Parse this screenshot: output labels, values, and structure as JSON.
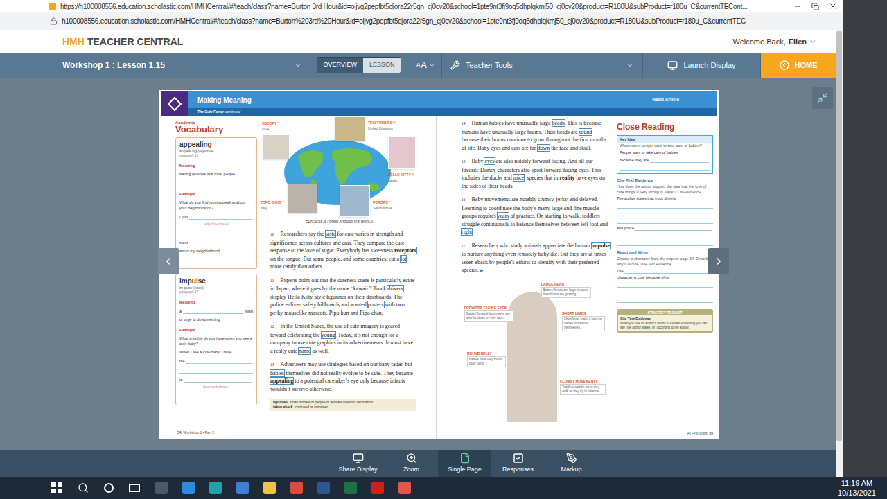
{
  "browser": {
    "title_url": "https://h100008556.education.scholastic.com/HMHCentral/#/teach/class?name=Burton 3rd Hour&id=oijvg2pepfbt5djora22r5gn_cj0cv20&school=1pte9nt3fj9oq5dhplqkmj50_cj0cv20&product=R180U&subProduct=r180u_C&currentTECont...",
    "address": "h100008556.education.scholastic.com/HMHCentral/#/teach/class?name=Burton%203rd%20Hour&id=oijvg2pepfbt5djora22r5gn_cj0cv20&school=1pte9nt3fj9oq5dhplqkmj50_cj0cv20&product=R180U&subProduct=r180u_C&currentTEC",
    "scrollbar": {
      "level": 0.92
    }
  },
  "header": {
    "brand": "HMH",
    "product": "TEACHER CENTRAL",
    "welcome": "Welcome Back,",
    "user": "Ellen"
  },
  "nav": {
    "lesson": "Workshop 1 : Lesson 1.15",
    "view_toggle": [
      {
        "label": "OVERVIEW",
        "selected": true
      },
      {
        "label": "LESSON",
        "selected": false
      }
    ],
    "text_size": {
      "small": "A",
      "large": "A"
    },
    "tools": "Teacher Tools",
    "launch": "Launch Display",
    "home": "HOME"
  },
  "document": {
    "header": {
      "title": "Making Meaning",
      "subtitle": "The Cute Factor",
      "subtitle_tail": "continued",
      "genre": "News Article"
    },
    "vocabulary": {
      "kicker": "Academic",
      "title": "Vocabulary",
      "cards": [
        {
          "word": "appealing",
          "pronunciation": "ap·peal·ing (adjective)",
          "paragraph": "paragraph 13",
          "rows": [
            {
              "kind": "label",
              "text": "Meaning"
            },
            {
              "kind": "text",
              "text": "having qualities that most people"
            },
            {
              "kind": "blank"
            },
            {
              "kind": "label",
              "text": "Example"
            },
            {
              "kind": "italic",
              "text": "What do you find most appealing about your neighborhood?"
            },
            {
              "kind": "fill",
              "before": "I find",
              "after": ""
            },
            {
              "kind": "hint",
              "text": "(adjective phrase)"
            },
            {
              "kind": "blank"
            },
            {
              "kind": "fill",
              "before": "most",
              "after": ""
            },
            {
              "kind": "text",
              "text": "about my neighborhood."
            }
          ]
        },
        {
          "word": "impulse",
          "pronunciation": "im·pulse (noun)",
          "paragraph": "paragraph 17",
          "rows": [
            {
              "kind": "label",
              "text": "Meaning"
            },
            {
              "kind": "fill",
              "before": "a",
              "after": "wish"
            },
            {
              "kind": "text",
              "text": "or urge to do something"
            },
            {
              "kind": "label",
              "text": "Example"
            },
            {
              "kind": "italic",
              "text": "What impulse do you have when you see a cute baby?"
            },
            {
              "kind": "text",
              "text": "When I see a cute baby, I have"
            },
            {
              "kind": "fill",
              "before": "the",
              "after": ""
            },
            {
              "kind": "blank"
            },
            {
              "kind": "fill",
              "before": "to",
              "after": ""
            },
            {
              "kind": "hint",
              "text": "(base verb phrase)"
            }
          ]
        }
      ]
    },
    "map": {
      "pins": [
        {
          "name": "SNOOPY™",
          "country": "USA"
        },
        {
          "name": "TELETUBBIES™",
          "country": "United Kingdom"
        },
        {
          "name": "HELLO KITTY™",
          "country": "Japan"
        },
        {
          "name": "TOPO GIGIO™",
          "country": "Italy"
        },
        {
          "name": "PORORO™",
          "country": "South Korea"
        }
      ],
      "caption": "CUTENESS IS FOUND AROUND THE WORLD."
    },
    "paragraphs_left": [
      {
        "num": "10",
        "parts": [
          {
            "text": "Researchers say the ",
            "bold": false,
            "boxed": false
          },
          {
            "text": "taste",
            "bold": false,
            "boxed": true
          },
          {
            "text": " for cute varies in strength and significance across cultures and eras. They compare the cute response to the love of sugar. Everybody has sweetness ",
            "bold": false,
            "boxed": false
          },
          {
            "text": "receptors",
            "bold": true,
            "boxed": true
          },
          {
            "text": " on the tongue. But some people, and some countries, eat a ",
            "bold": false,
            "boxed": false
          },
          {
            "text": "lot",
            "bold": false,
            "boxed": true
          },
          {
            "text": " more candy than others.",
            "bold": false,
            "boxed": false
          }
        ]
      },
      {
        "num": "11",
        "parts": [
          {
            "text": "Experts point out that the cuteness craze is particularly acute in Japan, where it goes by the name “kawaii.” Truck ",
            "bold": false,
            "boxed": false
          },
          {
            "text": "drivers",
            "bold": false,
            "boxed": true
          },
          {
            "text": " display Hello Kitty-style figurines on their dashboards. The police enliven safety billboards and wanted ",
            "bold": false,
            "boxed": false
          },
          {
            "text": "posters",
            "bold": false,
            "boxed": true
          },
          {
            "text": " with two perky mouselike mascots, Pipo kun and Pipo chan.",
            "bold": false,
            "boxed": false
          }
        ]
      },
      {
        "num": "12",
        "parts": [
          {
            "text": "In the United States, the use of cute imagery is geared toward celebrating the ",
            "bold": false,
            "boxed": false
          },
          {
            "text": "young",
            "bold": false,
            "boxed": true
          },
          {
            "text": ". Today, it’s not enough for a company to use cute graphics in its advertisements. It must have a really cute ",
            "bold": false,
            "boxed": false
          },
          {
            "text": "name",
            "bold": false,
            "boxed": true
          },
          {
            "text": " as well.",
            "bold": false,
            "boxed": false
          }
        ]
      },
      {
        "num": "13",
        "parts": [
          {
            "text": "Advertisers may use strategies based on our baby radar, but ",
            "bold": false,
            "boxed": false
          },
          {
            "text": "babies",
            "bold": false,
            "boxed": true
          },
          {
            "text": " themselves did not really evolve to be cute. They became ",
            "bold": false,
            "boxed": false
          },
          {
            "text": "appealing",
            "bold": true,
            "boxed": true
          },
          {
            "text": " to a potential caretaker’s eye only because infants wouldn’t survive otherwise.",
            "bold": false,
            "boxed": false
          }
        ]
      }
    ],
    "glossary": [
      {
        "term": "figurines",
        "definition": "small models of people or animals used for decoration"
      },
      {
        "term": "taken aback",
        "definition": "confused or surprised"
      }
    ],
    "footer_left": {
      "page": "54",
      "section": "Workshop 1 • Part 2"
    },
    "paragraphs_right": [
      {
        "num": "14",
        "parts": [
          {
            "text": "Human babies have unusually large ",
            "bold": false,
            "boxed": false
          },
          {
            "text": "heads",
            "bold": false,
            "boxed": true
          },
          {
            "text": ". This is because humans have unusually large brains. Their heads are ",
            "bold": false,
            "boxed": false
          },
          {
            "text": "round",
            "bold": false,
            "boxed": true
          },
          {
            "text": " because their brains continue to grow throughout the first months of life. Baby eyes and ears are far ",
            "bold": false,
            "boxed": false
          },
          {
            "text": "down",
            "bold": false,
            "boxed": true
          },
          {
            "text": " the face and skull.",
            "bold": false,
            "boxed": false
          }
        ]
      },
      {
        "num": "15",
        "parts": [
          {
            "text": "Baby ",
            "bold": false,
            "boxed": false
          },
          {
            "text": "eyes",
            "bold": false,
            "boxed": true
          },
          {
            "text": " are also notably forward facing. And all our favorite Disney characters also sport forward-facing eyes. This includes the ducks and ",
            "bold": false,
            "boxed": false
          },
          {
            "text": "mice",
            "bold": false,
            "boxed": true
          },
          {
            "text": ", species that in ",
            "bold": false,
            "boxed": false
          },
          {
            "text": "reality",
            "bold": true,
            "boxed": false
          },
          {
            "text": " have eyes on the sides of their heads.",
            "bold": false,
            "boxed": false
          }
        ]
      },
      {
        "num": "16",
        "parts": [
          {
            "text": "Baby movements are notably clumsy, jerky, and delayed. Learning to coordinate the body’s many large and fine muscle groups requires ",
            "bold": false,
            "boxed": false
          },
          {
            "text": "years",
            "bold": false,
            "boxed": true
          },
          {
            "text": " of practice. On starting to walk, toddlers struggle continuously to balance themselves between left foot and ",
            "bold": false,
            "boxed": false
          },
          {
            "text": "right",
            "bold": false,
            "boxed": true
          },
          {
            "text": ".",
            "bold": false,
            "boxed": false
          }
        ]
      },
      {
        "num": "17",
        "parts": [
          {
            "text": "Researchers who study animals appreciate the human ",
            "bold": false,
            "boxed": false
          },
          {
            "text": "impulse",
            "bold": true,
            "boxed": true
          },
          {
            "text": " to nurture anything even remotely babylike. But they are at times taken aback by people’s efforts to identify with their preferred species. ",
            "bold": false,
            "boxed": false
          }
        ]
      }
    ],
    "continue_mark": "▶",
    "callouts": [
      {
        "label": "LARGE HEAD",
        "text": "Babies’ heads are large because their brains are growing."
      },
      {
        "label": "FORWARD-FACING EYES",
        "text": "Babies’ forward-facing eyes are also far down on their face."
      },
      {
        "label": "SHORT LIMBS",
        "text": "Short limbs make it hard for babies to balance themselves."
      },
      {
        "label": "ROUND BELLY",
        "text": "Babies have very round body parts."
      },
      {
        "label": "CLUMSY MOVEMENTS",
        "text": "Toddlers wobble when they walk as they try to balance."
      }
    ],
    "close_reading": {
      "title": "Close Reading",
      "key_idea": {
        "label": "Key Idea",
        "rows": [
          {
            "kind": "prompt",
            "text": "What makes people want to take care of babies?"
          },
          {
            "kind": "text",
            "text": "People want to take care of babies"
          },
          {
            "kind": "fill",
            "before": "because they are",
            "after": ""
          },
          {
            "kind": "blank"
          }
        ]
      },
      "sections": [
        {
          "title": "Cite Text Evidence",
          "rows": [
            {
              "kind": "prompt",
              "text": "How does the author support the idea that the love of cute things is very strong in Japan? Cite evidence."
            },
            {
              "kind": "text",
              "text": "The author states that truck drivers"
            },
            {
              "kind": "blank"
            },
            {
              "kind": "blank"
            },
            {
              "kind": "blank"
            },
            {
              "kind": "fill",
              "before": "and police",
              "after": ""
            },
            {
              "kind": "blank"
            },
            {
              "kind": "blank"
            }
          ]
        },
        {
          "title": "React and Write",
          "rows": [
            {
              "kind": "prompt",
              "text": "Choose a character from the map on page 54. Describe why it is cute. Use text evidence."
            },
            {
              "kind": "fill",
              "before": "The",
              "after": ""
            },
            {
              "kind": "text",
              "text": "character is cute because of its"
            },
            {
              "kind": "blank"
            },
            {
              "kind": "blank"
            },
            {
              "kind": "blank"
            }
          ]
        }
      ],
      "toolkit": {
        "label": "STRATEGY TOOLKIT",
        "title": "Cite Text Evidence",
        "text": "When you use an author’s words to explain something you can say “the author states” or “according to the author.”"
      }
    },
    "footer_right": {
      "section": "At First Sight",
      "page": "55"
    }
  },
  "toolbar": [
    {
      "label": "Share Display",
      "selected": false
    },
    {
      "label": "Zoom",
      "selected": false
    },
    {
      "label": "Single Page",
      "selected": true
    },
    {
      "label": "Responses",
      "selected": false
    },
    {
      "label": "Markup",
      "selected": false
    }
  ],
  "taskbar": {
    "time": "11:19 AM",
    "date": "10/13/2021"
  }
}
